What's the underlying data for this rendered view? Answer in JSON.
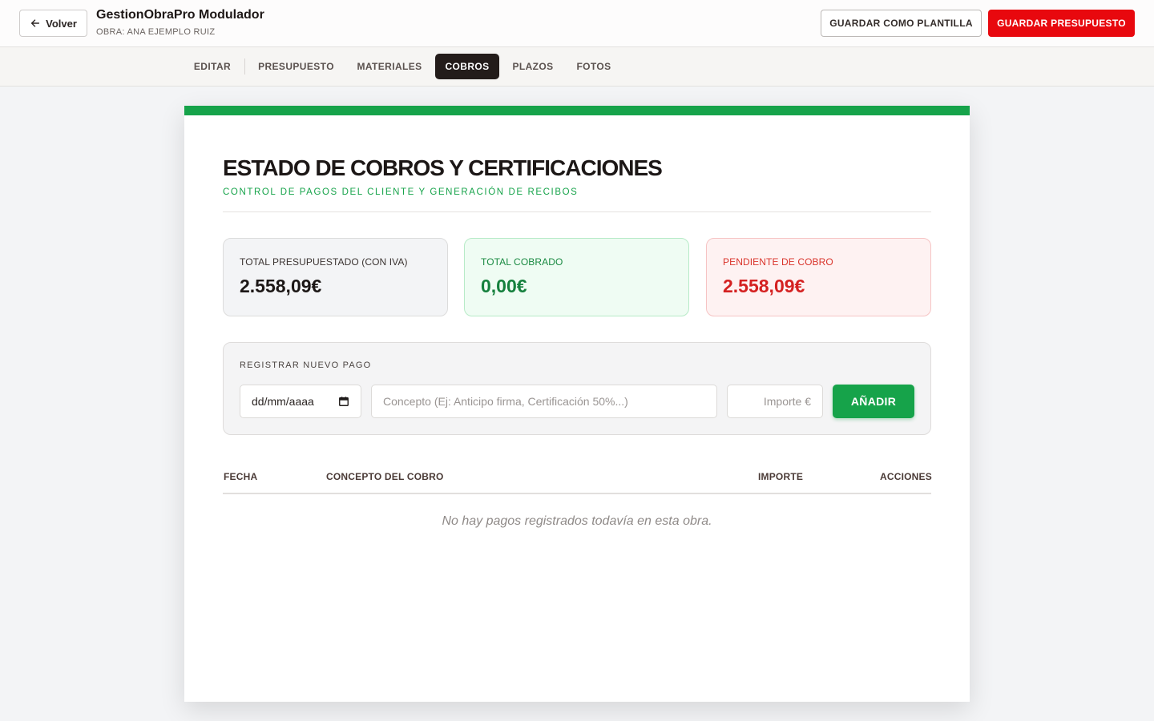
{
  "header": {
    "back_label": "Volver",
    "app_title": "GestionObraPro Modulador",
    "project_label": "OBRA: ANA EJEMPLO RUIZ",
    "save_template_label": "GUARDAR COMO PLANTILLA",
    "save_budget_label": "GUARDAR PRESUPUESTO"
  },
  "tabs": [
    {
      "label": "EDITAR",
      "active": false
    },
    {
      "label": "PRESUPUESTO",
      "active": false
    },
    {
      "label": "MATERIALES",
      "active": false
    },
    {
      "label": "COBROS",
      "active": true
    },
    {
      "label": "PLAZOS",
      "active": false
    },
    {
      "label": "FOTOS",
      "active": false
    }
  ],
  "page": {
    "title": "ESTADO DE COBROS Y CERTIFICACIONES",
    "subtitle": "CONTROL DE PAGOS DEL CLIENTE Y GENERACIÓN DE RECIBOS"
  },
  "stats": {
    "budgeted": {
      "label": "TOTAL PRESUPUESTADO (CON IVA)",
      "value": "2.558,09€"
    },
    "collected": {
      "label": "TOTAL COBRADO",
      "value": "0,00€"
    },
    "pending": {
      "label": "PENDIENTE DE COBRO",
      "value": "2.558,09€"
    }
  },
  "payment_form": {
    "title": "REGISTRAR NUEVO PAGO",
    "date_placeholder": "dd/mm/aaaa",
    "concept_placeholder": "Concepto (Ej: Anticipo firma, Certificación 50%...)",
    "amount_placeholder": "Importe €",
    "add_label": "AÑADIR"
  },
  "table": {
    "columns": [
      "FECHA",
      "CONCEPTO DEL COBRO",
      "IMPORTE",
      "ACCIONES"
    ],
    "rows": [],
    "empty_message": "No hay pagos registrados todavía en esta obra."
  },
  "colors": {
    "accent_green": "#16a34a",
    "accent_red": "#e8080e",
    "active_tab": "#231c1a"
  }
}
